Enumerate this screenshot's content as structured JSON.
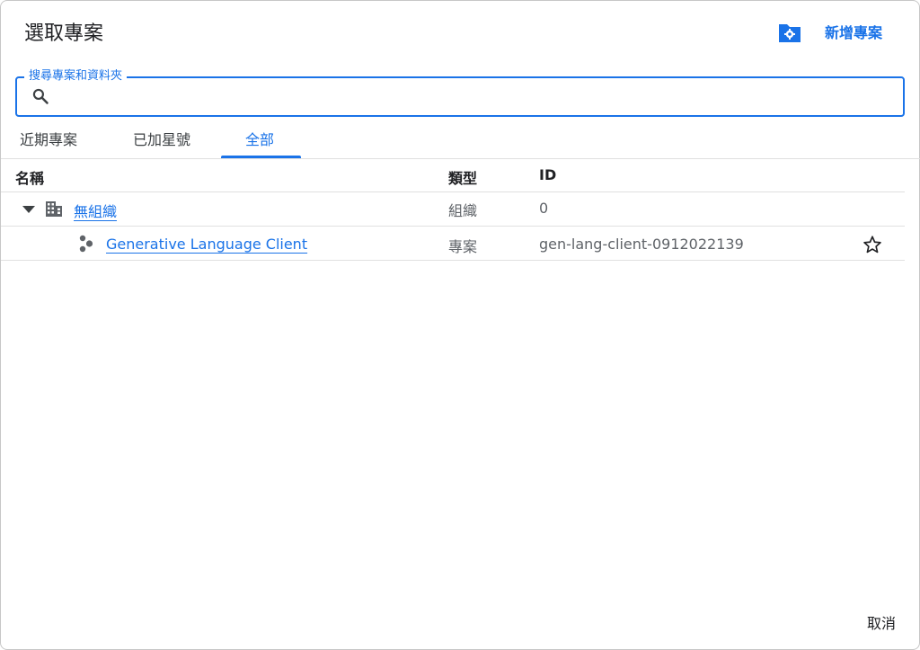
{
  "dialog": {
    "title": "選取專案",
    "new_project_label": "新增專案",
    "cancel_label": "取消"
  },
  "search": {
    "label": "搜尋專案和資料夾",
    "value": ""
  },
  "tabs": [
    {
      "label": "近期專案",
      "active": false
    },
    {
      "label": "已加星號",
      "active": false
    },
    {
      "label": "全部",
      "active": true
    }
  ],
  "table": {
    "headers": {
      "name": "名稱",
      "type": "類型",
      "id": "ID"
    },
    "rows": [
      {
        "name": "無組織",
        "type": "組織",
        "id": "0",
        "icon": "organization-icon",
        "expanded": true
      },
      {
        "name": "Generative Language Client",
        "type": "專案",
        "id": "gen-lang-client-0912022139",
        "icon": "project-icon",
        "starred": false
      }
    ]
  },
  "colors": {
    "accent": "#1a73e8",
    "text": "#202124",
    "secondary_text": "#5f6368",
    "divider": "#e0e0e0"
  }
}
